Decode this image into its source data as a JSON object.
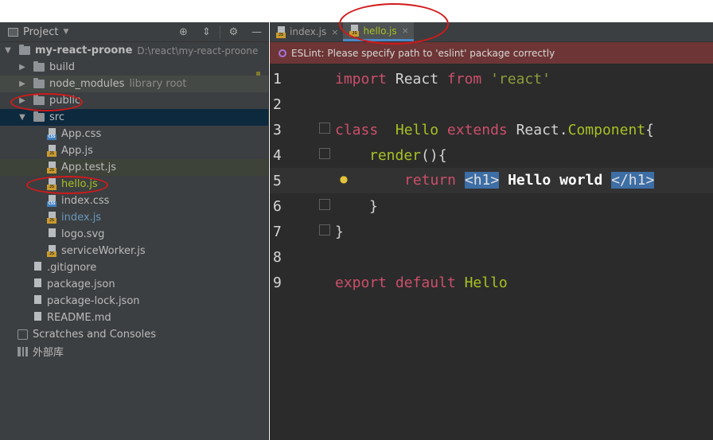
{
  "project": {
    "title": "Project",
    "header_icons": [
      "target-icon",
      "collapse-icon",
      "gear-icon",
      "minimize-icon"
    ],
    "tree": [
      {
        "label": "my-react-proone",
        "hint": "D:\\react\\my-react-proone",
        "type": "root-folder"
      },
      {
        "label": "build",
        "type": "folder"
      },
      {
        "label": "node_modules",
        "hint": "library root",
        "type": "folder"
      },
      {
        "label": "public",
        "type": "folder"
      },
      {
        "label": "src",
        "type": "folder"
      },
      {
        "label": "App.css",
        "type": "css"
      },
      {
        "label": "App.js",
        "type": "js"
      },
      {
        "label": "App.test.js",
        "type": "js"
      },
      {
        "label": "hello.js",
        "type": "js"
      },
      {
        "label": "index.css",
        "type": "css"
      },
      {
        "label": "index.js",
        "type": "js"
      },
      {
        "label": "logo.svg",
        "type": "svg"
      },
      {
        "label": "serviceWorker.js",
        "type": "js"
      },
      {
        "label": ".gitignore",
        "type": "git"
      },
      {
        "label": "package.json",
        "type": "json"
      },
      {
        "label": "package-lock.json",
        "type": "json"
      },
      {
        "label": "README.md",
        "type": "md"
      },
      {
        "label": "Scratches and Consoles",
        "type": "scratch"
      },
      {
        "label": "外部库",
        "type": "library"
      }
    ]
  },
  "editor": {
    "tabs": [
      {
        "label": "index.js",
        "active": false,
        "close": "×"
      },
      {
        "label": "hello.js",
        "active": true,
        "close": "×"
      }
    ],
    "banner": "ESLint: Please specify path to 'eslint' package correctly",
    "line_numbers": [
      "1",
      "2",
      "3",
      "4",
      "5",
      "6",
      "7",
      "8",
      "9"
    ],
    "code": {
      "l1": {
        "kw": "import",
        "name": " React ",
        "from": "from",
        "str": " 'react'"
      },
      "l3": {
        "kw": "class",
        "name": "  Hello ",
        "ext": "extends",
        "sp": " React.",
        "comp": "Component",
        "brace": "{"
      },
      "l4": {
        "method": "render",
        "rest": "(){"
      },
      "l5": {
        "ret": "return",
        "open": "<h1>",
        "text": " Hello world ",
        "close": "</h1>"
      },
      "l6": {
        "brace": "}"
      },
      "l7": {
        "brace": "}"
      },
      "l9": {
        "kw1": "export",
        "kw2": "default",
        "name": " Hello"
      }
    }
  },
  "colors": {
    "panel_bg": "#3c3f41",
    "editor_bg": "#2b2b2b",
    "banner_bg": "#6d3535",
    "annotation": "#d11a1a",
    "keyword": "#cc7832"
  }
}
